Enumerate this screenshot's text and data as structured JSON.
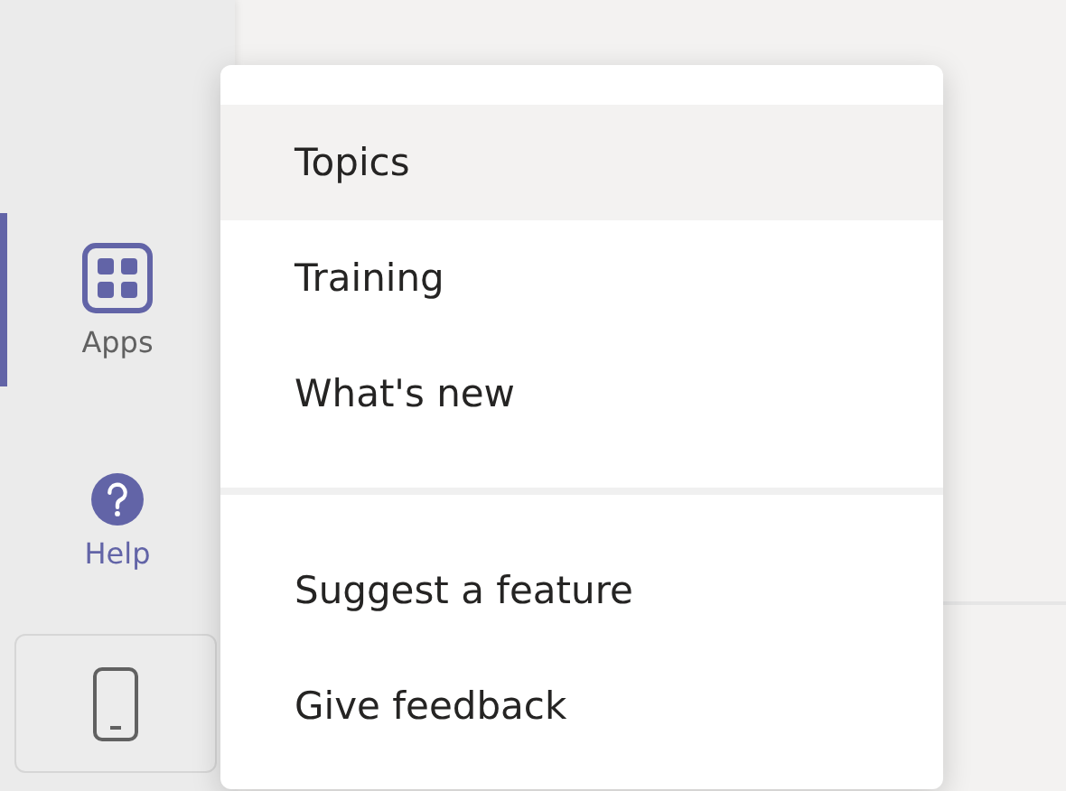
{
  "sidebar": {
    "items": [
      {
        "label": "Apps",
        "kind": "apps",
        "selected": true
      },
      {
        "label": "Help",
        "kind": "help",
        "selected": false
      }
    ]
  },
  "menu": {
    "groups": [
      [
        {
          "label": "Topics",
          "selected": true
        },
        {
          "label": "Training",
          "selected": false
        },
        {
          "label": "What's new",
          "selected": false
        }
      ],
      [
        {
          "label": "Suggest a feature",
          "selected": false
        },
        {
          "label": "Give feedback",
          "selected": false
        }
      ]
    ]
  }
}
